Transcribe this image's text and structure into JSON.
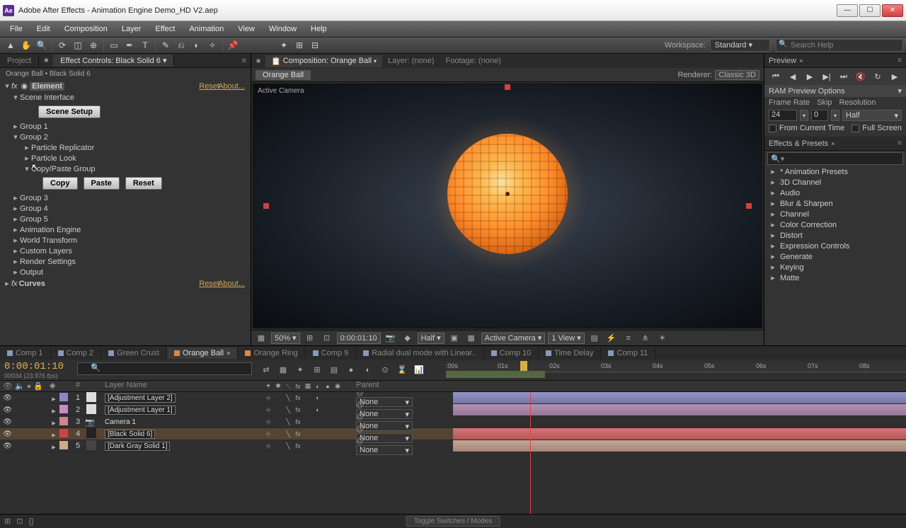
{
  "window": {
    "app_icon": "Ae",
    "title": "Adobe After Effects - Animation Engine Demo_HD V2.aep"
  },
  "menus": [
    "File",
    "Edit",
    "Composition",
    "Layer",
    "Effect",
    "Animation",
    "View",
    "Window",
    "Help"
  ],
  "workspace": {
    "label": "Workspace:",
    "value": "Standard"
  },
  "search_help_placeholder": "Search Help",
  "left": {
    "tabs": {
      "project": "Project",
      "fx": "Effect Controls: Black Solid 6"
    },
    "breadcrumb": "Orange Ball • Black Solid 6",
    "effects": [
      {
        "name": "Element",
        "reset": "Reset",
        "about": "About..."
      }
    ],
    "curves": {
      "name": "Curves",
      "reset": "Reset",
      "about": "About..."
    },
    "tree": {
      "scene_interface": "Scene Interface",
      "scene_setup": "Scene Setup",
      "g1": "Group 1",
      "g2": "Group 2",
      "particle_replicator": "Particle Replicator",
      "particle_look": "Particle Look",
      "copy_paste": "Copy/Paste Group",
      "copy": "Copy",
      "paste": "Paste",
      "reset": "Reset",
      "g3": "Group 3",
      "g4": "Group 4",
      "g5": "Group 5",
      "anim_engine": "Animation Engine",
      "world_transform": "World Transform",
      "custom_layers": "Custom Layers",
      "render_settings": "Render Settings",
      "output": "Output"
    }
  },
  "center": {
    "tabs": {
      "comp": "Composition: Orange Ball",
      "layer": "Layer: (none)",
      "footage": "Footage: (none)"
    },
    "subtab": "Orange Ball",
    "renderer_label": "Renderer:",
    "renderer_value": "Classic 3D",
    "camera_label": "Active Camera",
    "footer": {
      "zoom": "50%",
      "timecode": "0:00:01:10",
      "res": "Half",
      "view_mode": "Active Camera",
      "views": "1 View"
    }
  },
  "right": {
    "preview": "Preview",
    "ram_options": "RAM Preview Options",
    "frame_rate": "Frame Rate",
    "skip": "Skip",
    "resolution": "Resolution",
    "fr_val": "24",
    "skip_val": "0",
    "res_val": "Half",
    "from_current": "From Current Time",
    "fullscreen": "Full Screen",
    "effects_presets": "Effects & Presets",
    "presets": [
      "* Animation Presets",
      "3D Channel",
      "Audio",
      "Blur & Sharpen",
      "Channel",
      "Color Correction",
      "Distort",
      "Expression Controls",
      "Generate",
      "Keying",
      "Matte"
    ]
  },
  "comp_tabs": [
    "Comp 1",
    "Comp 2",
    "Green Crust",
    "Orange Ball",
    "Orange Ring",
    "Comp 9",
    "Radial dual mode with Linear..",
    "Comp 10",
    "Time Delay",
    "Comp 11"
  ],
  "comp_tabs_active_index": 3,
  "timeline": {
    "timecode": "0:00:01:10",
    "fps": "00034 (23.976 fps)",
    "col_layer_name": "Layer Name",
    "col_parent": "Parent",
    "ticks": [
      ":00s",
      "01s",
      "02s",
      "03s",
      "04s",
      "05s",
      "06s",
      "07s",
      "08s"
    ],
    "layers": [
      {
        "num": "1",
        "color": "#8888cc",
        "name": "[Adjustment Layer 2]",
        "parent": "None",
        "boxed": true,
        "src": "#ddd"
      },
      {
        "num": "2",
        "color": "#cc88cc",
        "name": "[Adjustment Layer 1]",
        "parent": "None",
        "boxed": true,
        "src": "#ddd"
      },
      {
        "num": "3",
        "color": "#cc8888",
        "name": "Camera 1",
        "parent": "None",
        "boxed": false,
        "src": null
      },
      {
        "num": "4",
        "color": "#cc4444",
        "name": "[Black Solid 6]",
        "parent": "None",
        "boxed": true,
        "src": "#222",
        "sel": true
      },
      {
        "num": "5",
        "color": "#ccaa88",
        "name": "[Dark Gray Solid 1]",
        "parent": "None",
        "boxed": true,
        "src": "#444"
      }
    ]
  },
  "statusbar": {
    "toggle": "Toggle Switches / Modes"
  }
}
